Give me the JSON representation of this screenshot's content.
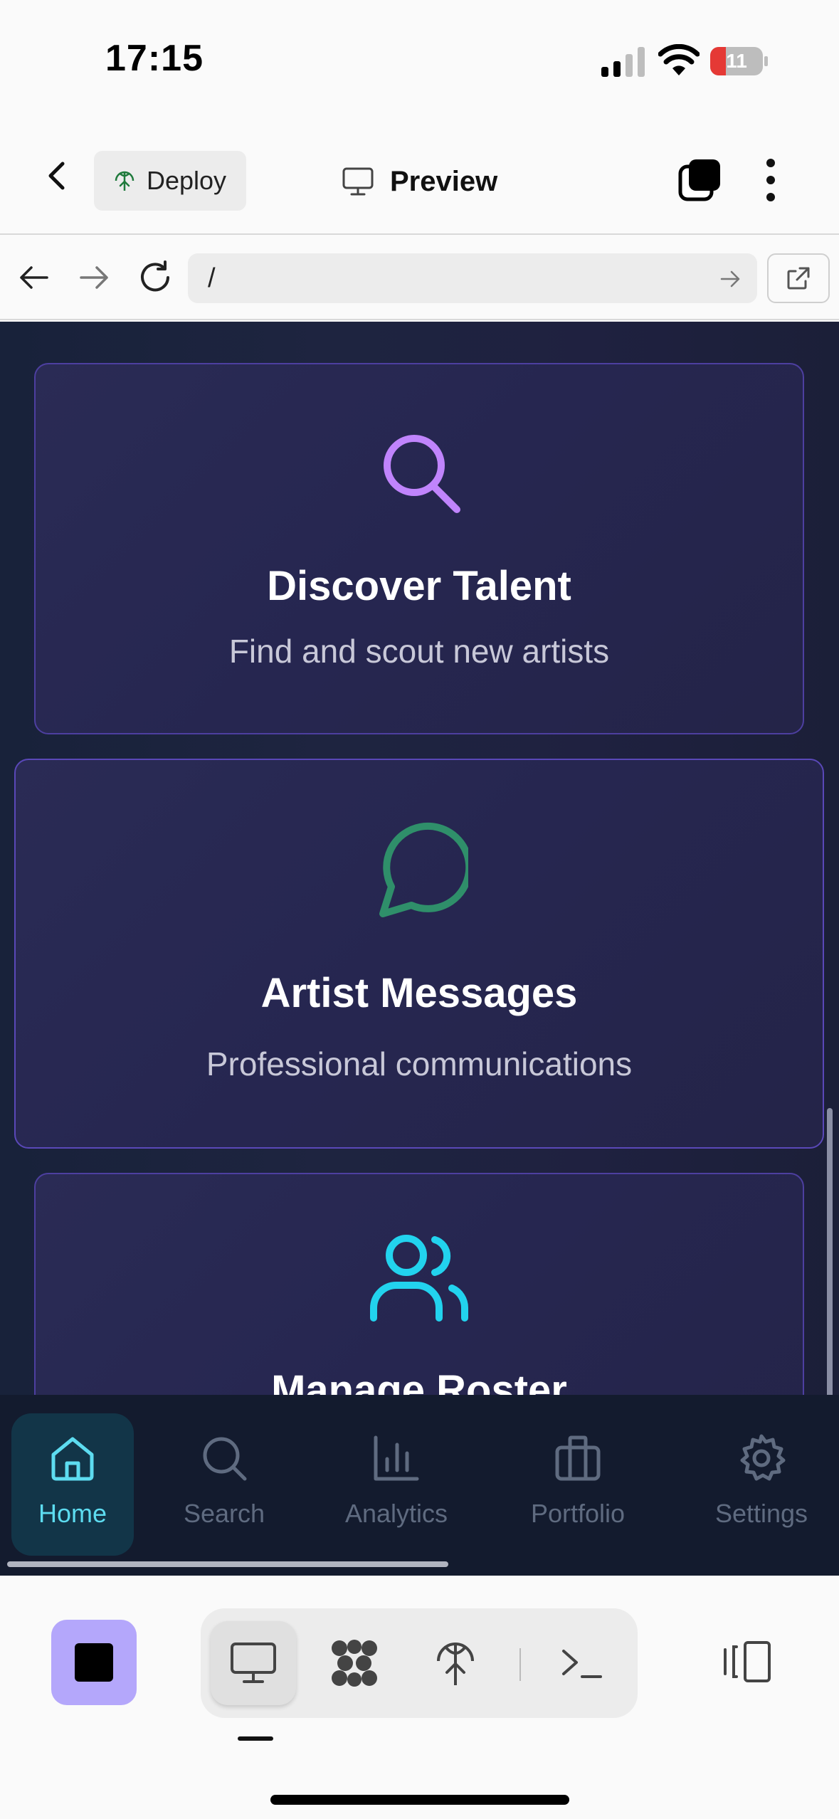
{
  "status_bar": {
    "time": "17:15",
    "battery_level": "11",
    "battery_fraction": 0.11
  },
  "header": {
    "deploy_label": "Deploy",
    "preview_label": "Preview"
  },
  "url_bar": {
    "path": "/"
  },
  "cards": [
    {
      "title": "Discover Talent",
      "subtitle": "Find and scout new artists",
      "icon": "search-icon",
      "icon_color": "#c084fc"
    },
    {
      "title": "Artist Messages",
      "subtitle": "Professional communications",
      "icon": "message-circle-icon",
      "icon_color": "#2f8f6a"
    },
    {
      "title": "Manage Roster",
      "icon": "users-icon",
      "icon_color": "#22d3ee"
    }
  ],
  "app_nav": {
    "items": [
      {
        "label": "Home",
        "icon": "home-icon",
        "active": true
      },
      {
        "label": "Search",
        "icon": "search-icon"
      },
      {
        "label": "Analytics",
        "icon": "bar-chart-icon"
      },
      {
        "label": "Portfolio",
        "icon": "briefcase-icon"
      },
      {
        "label": "Settings",
        "icon": "gear-icon"
      }
    ],
    "active_color": "#5ddcf0",
    "inactive_color": "#5f6b80"
  },
  "toolbar": {
    "tools": [
      "desktop-preview-icon",
      "database-icon",
      "deploy-icon",
      "terminal-icon"
    ],
    "accent": "#b4a7fb"
  }
}
